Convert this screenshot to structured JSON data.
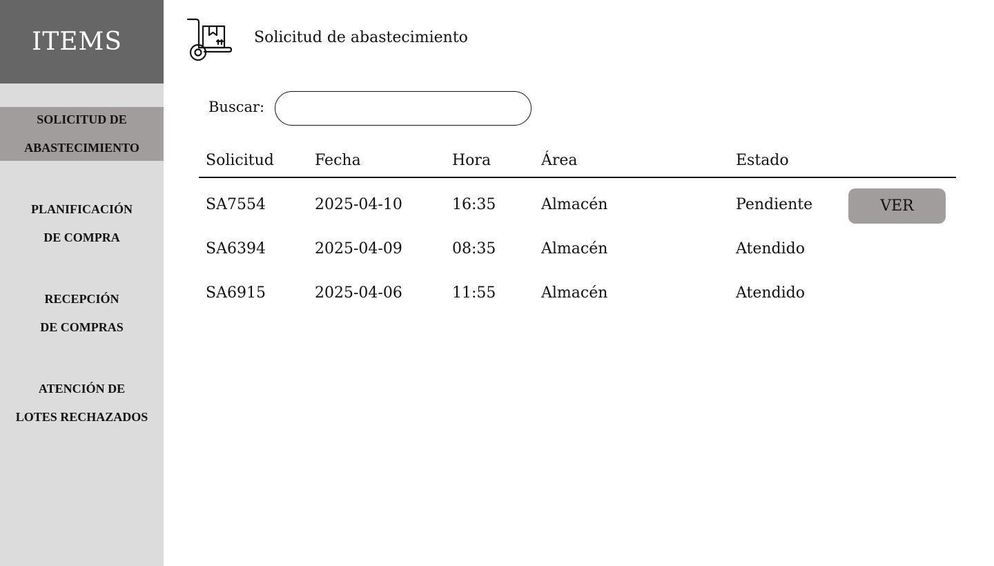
{
  "sidebar": {
    "title": "ITEMS",
    "items": [
      {
        "line1": "SOLICITUD DE",
        "line2": "ABASTECIMIENTO",
        "active": true
      },
      {
        "line1": "PLANIFICACIÓN",
        "line2": "DE COMPRA",
        "active": false
      },
      {
        "line1": "RECEPCIÓN",
        "line2": "DE COMPRAS",
        "active": false
      },
      {
        "line1": "ATENCIÓN DE",
        "line2": "LOTES RECHAZADOS",
        "active": false
      }
    ]
  },
  "header": {
    "icon": "hand-truck-box-icon",
    "title": "Solicitud de abastecimiento"
  },
  "search": {
    "label": "Buscar:",
    "value": "",
    "placeholder": ""
  },
  "table": {
    "columns": [
      "Solicitud",
      "Fecha",
      "Hora",
      "Área",
      "Estado"
    ],
    "rows": [
      {
        "solicitud": "SA7554",
        "fecha": "2025-04-10",
        "hora": "16:35",
        "area": "Almacén",
        "estado": "Pendiente",
        "action": "VER"
      },
      {
        "solicitud": "SA6394",
        "fecha": "2025-04-09",
        "hora": "08:35",
        "area": "Almacén",
        "estado": "Atendido"
      },
      {
        "solicitud": "SA6915",
        "fecha": "2025-04-06",
        "hora": "11:55",
        "area": "Almacén",
        "estado": "Atendido"
      }
    ]
  },
  "colors": {
    "sidebar_header": "#666666",
    "sidebar_bg": "#dcdcdc",
    "active_item": "#a19d9d",
    "button": "#a19d9d"
  }
}
